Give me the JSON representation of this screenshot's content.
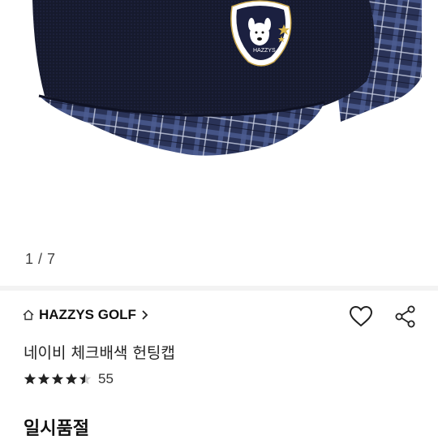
{
  "gallery": {
    "page_indicator": "1 / 7",
    "image_alt": "navy check hunting cap"
  },
  "brand": {
    "name": "HAZZYS GOLF",
    "home_icon": "home-icon",
    "chevron_icon": "chevron-right-icon"
  },
  "actions": {
    "wishlist_icon": "heart-icon",
    "share_icon": "share-icon"
  },
  "product": {
    "name": "네이비 체크배색 헌팅캡",
    "rating_stars": 4.5,
    "review_count": "55",
    "status": "일시품절"
  },
  "colors": {
    "cap_navy": "#1a1f33",
    "check_blue": "#4a5a8a",
    "text_dark": "#111111"
  }
}
